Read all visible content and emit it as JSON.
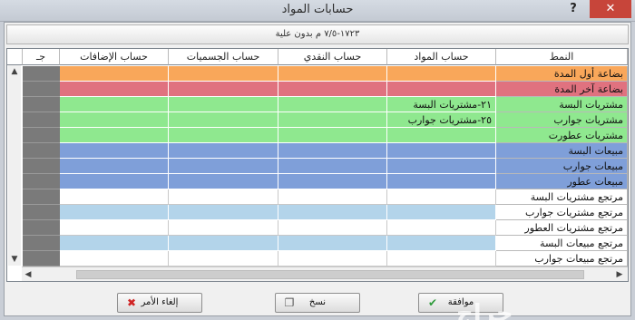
{
  "window": {
    "title": "حسابات المواد",
    "help_glyph": "?",
    "close_glyph": "✕"
  },
  "infobar": {
    "text": "١٧٢٣-٧/٥ م بدون علية"
  },
  "grid": {
    "columns": [
      {
        "label": "النمط"
      },
      {
        "label": "حساب المواد"
      },
      {
        "label": "حساب النقدي"
      },
      {
        "label": "حساب الجسميات"
      },
      {
        "label": "حساب الإضافات"
      },
      {
        "label": "جـ"
      }
    ],
    "rows": [
      {
        "name": "بضاعة أول المدة",
        "account": "",
        "color": "#f9a75a",
        "name_color": "#f9a75a"
      },
      {
        "name": "بضاعة آخر المدة",
        "account": "",
        "color": "#e0727f",
        "name_color": "#e0727f"
      },
      {
        "name": "مشتريات البسة",
        "account": "٢١-مشتريات البسة",
        "color": "#8fe88f",
        "name_color": "#8fe88f"
      },
      {
        "name": "مشتريات جوارب",
        "account": "٢٥-مشتريات جوارب",
        "color": "#8fe88f",
        "name_color": "#8fe88f"
      },
      {
        "name": "مشتريات عطورت",
        "account": "",
        "color": "#8fe88f",
        "name_color": "#8fe88f"
      },
      {
        "name": "مبيعات البسة",
        "account": "",
        "color": "#7f9fd9",
        "name_color": "#7f9fd9"
      },
      {
        "name": "مبيعات جوارب",
        "account": "",
        "color": "#7f9fd9",
        "name_color": "#7f9fd9"
      },
      {
        "name": "مبيعات عطور",
        "account": "",
        "color": "#7f9fd9",
        "name_color": "#7f9fd9"
      },
      {
        "name": "مرتجع مشتريات البسة",
        "account": "",
        "color": "#ffffff",
        "name_color": "#ffffff"
      },
      {
        "name": "مرتجع مشتريات جوارب",
        "account": "",
        "color": "#b3d4ea",
        "name_color": "#ffffff"
      },
      {
        "name": "مرتجع مشتريات العطور",
        "account": "",
        "color": "#ffffff",
        "name_color": "#ffffff"
      },
      {
        "name": "مرتجع مبيعات البسة",
        "account": "",
        "color": "#b3d4ea",
        "name_color": "#ffffff"
      },
      {
        "name": "مرتجع مبيعات جوارب",
        "account": "",
        "color": "#ffffff",
        "name_color": "#ffffff"
      }
    ]
  },
  "buttons": {
    "ok": "موافقة",
    "copy": "نسخ",
    "cancel": "إلغاء الأمر"
  },
  "watermark": "حراج"
}
